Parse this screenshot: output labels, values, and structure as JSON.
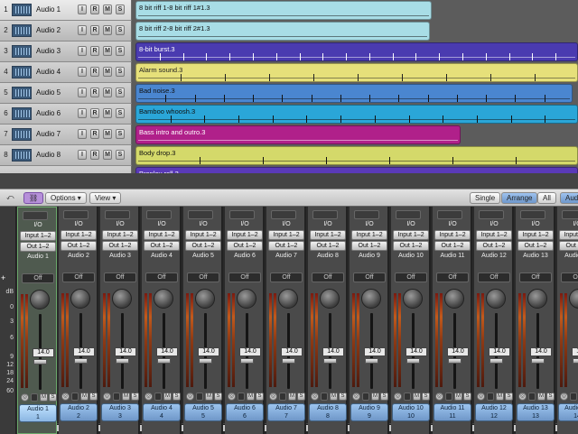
{
  "tracks": [
    {
      "num": "1",
      "name": "Audio 1"
    },
    {
      "num": "2",
      "name": "Audio 2"
    },
    {
      "num": "3",
      "name": "Audio 3"
    },
    {
      "num": "4",
      "name": "Audio 4"
    },
    {
      "num": "5",
      "name": "Audio 5"
    },
    {
      "num": "6",
      "name": "Audio 6"
    },
    {
      "num": "7",
      "name": "Audio 7"
    },
    {
      "num": "8",
      "name": "Audio 8"
    }
  ],
  "track_buttons": {
    "i": "I",
    "r": "R",
    "m": "M",
    "s": "S"
  },
  "regions": [
    {
      "name": "8 bit riff 1-8 bit riff 1#1.3",
      "color": "#a8dde6"
    },
    {
      "name": "8 bit riff 2-8 bit riff 2#1.3",
      "color": "#a8dde6"
    },
    {
      "name": "8-bit burst.3",
      "color": "#4a3bb0"
    },
    {
      "name": "Alarm sound.3",
      "color": "#e6e07a"
    },
    {
      "name": "Bad noise.3",
      "color": "#4a86d0"
    },
    {
      "name": "Bamboo whoosh.3",
      "color": "#2aa6d8"
    },
    {
      "name": "Bass intro and outro.3",
      "color": "#b0208a"
    },
    {
      "name": "Body drop.3",
      "color": "#d4d96a"
    },
    {
      "name": "Bronley roll.3",
      "color": "#5a3ab8"
    }
  ],
  "toolbar": {
    "options": "Options",
    "view": "View",
    "single": "Single",
    "arrange": "Arrange",
    "all": "All",
    "aud": "Aud"
  },
  "scale": [
    "dB",
    "0",
    "3",
    "6",
    "9",
    "12",
    "18",
    "24",
    "60"
  ],
  "mixer_labels": {
    "io": "I/O",
    "input": "Input 1–2",
    "out": "Out 1–2",
    "off": "Off",
    "volume": "14.0",
    "mute": "M",
    "solo": "S"
  },
  "channels": [
    "Audio 1",
    "Audio 2",
    "Audio 3",
    "Audio 4",
    "Audio 5",
    "Audio 6",
    "Audio 7",
    "Audio 8",
    "Audio 9",
    "Audio 10",
    "Audio 11",
    "Audio 12",
    "Audio 13",
    "Audio 14"
  ],
  "channel_nums": [
    "1",
    "2",
    "3",
    "4",
    "5",
    "6",
    "7",
    "8",
    "9",
    "10",
    "11",
    "12",
    "13",
    "14"
  ]
}
